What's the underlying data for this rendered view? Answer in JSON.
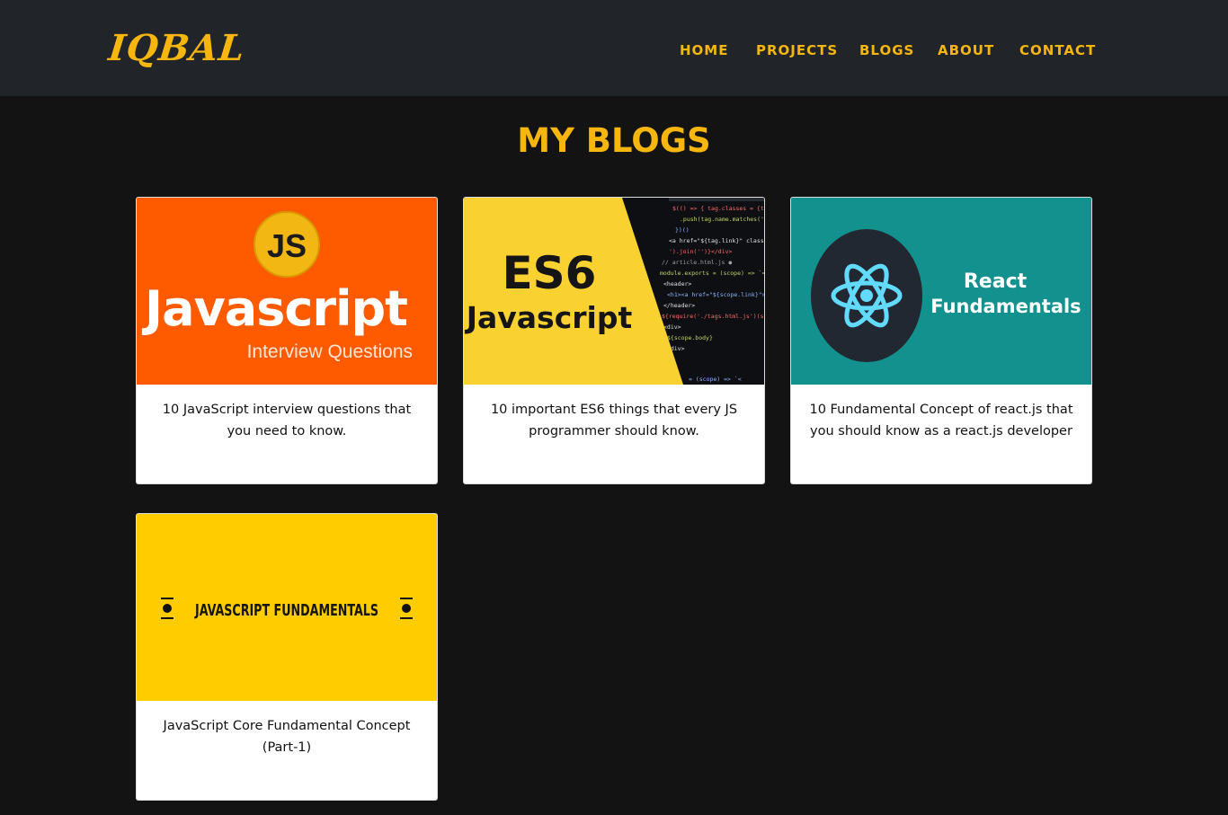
{
  "brand": "IQBAL",
  "nav": {
    "items": [
      "HOME",
      "PROJECTS",
      "BLOGS",
      "ABOUT",
      "CONTACT"
    ]
  },
  "page_title": "MY BLOGS",
  "colors": {
    "accent": "#f6b60e",
    "navbar_bg": "#212529",
    "page_bg": "#131313",
    "card_bg": "#ffffff"
  },
  "blogs": [
    {
      "title": "10 JavaScript interview questions that you need to know.",
      "thumbnail": {
        "icon": "js-badge-icon",
        "badge": "JS",
        "heading": "Javascript",
        "subheading": "Interview Questions",
        "bg": "#fe5a00"
      }
    },
    {
      "title": "10 important ES6 things that every JS programmer should know.",
      "thumbnail": {
        "icon": "code-snippet-icon",
        "heading": "ES6",
        "subheading": "Javascript",
        "bg": "#f9d131"
      }
    },
    {
      "title": "10 Fundamental Concept of react.js that you should know as a react.js developer",
      "thumbnail": {
        "icon": "react-atom-icon",
        "heading": "React",
        "subheading": "Fundamentals",
        "bg": "#12918f"
      }
    },
    {
      "title": "JavaScript Core Fundamental Concept (Part-1)",
      "thumbnail": {
        "icon": "bullet-marker-icon",
        "heading": "JAVASCRIPT FUNDAMENTALS",
        "bg": "#ffcc00"
      }
    }
  ]
}
